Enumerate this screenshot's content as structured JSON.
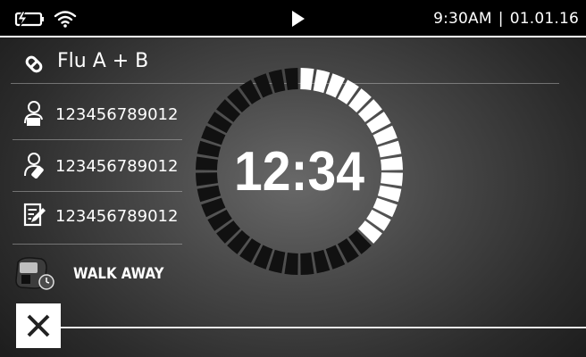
{
  "status_bar": {
    "charging_icon": "battery-charging-icon",
    "wifi_icon": "wifi-icon",
    "play_icon": "play-icon",
    "time": "9:30AM",
    "separator": "|",
    "date": "01.01.16"
  },
  "test": {
    "icon": "swab-icon",
    "name": "Flu A + B"
  },
  "ids": [
    {
      "icon": "patient-icon",
      "value": "123456789012"
    },
    {
      "icon": "operator-icon",
      "value": "123456789012"
    },
    {
      "icon": "order-icon",
      "value": "123456789012"
    }
  ],
  "walk_away": {
    "icon": "device-timer-icon",
    "label": "WALK AWAY"
  },
  "timer": {
    "display": "12:34",
    "total_segments": 40,
    "progress": 0.375
  },
  "close": {
    "icon": "close-icon"
  },
  "colors": {
    "segment_done": "#ffffff",
    "segment_pending": "#111111",
    "status_bar_bg": "#000000"
  }
}
